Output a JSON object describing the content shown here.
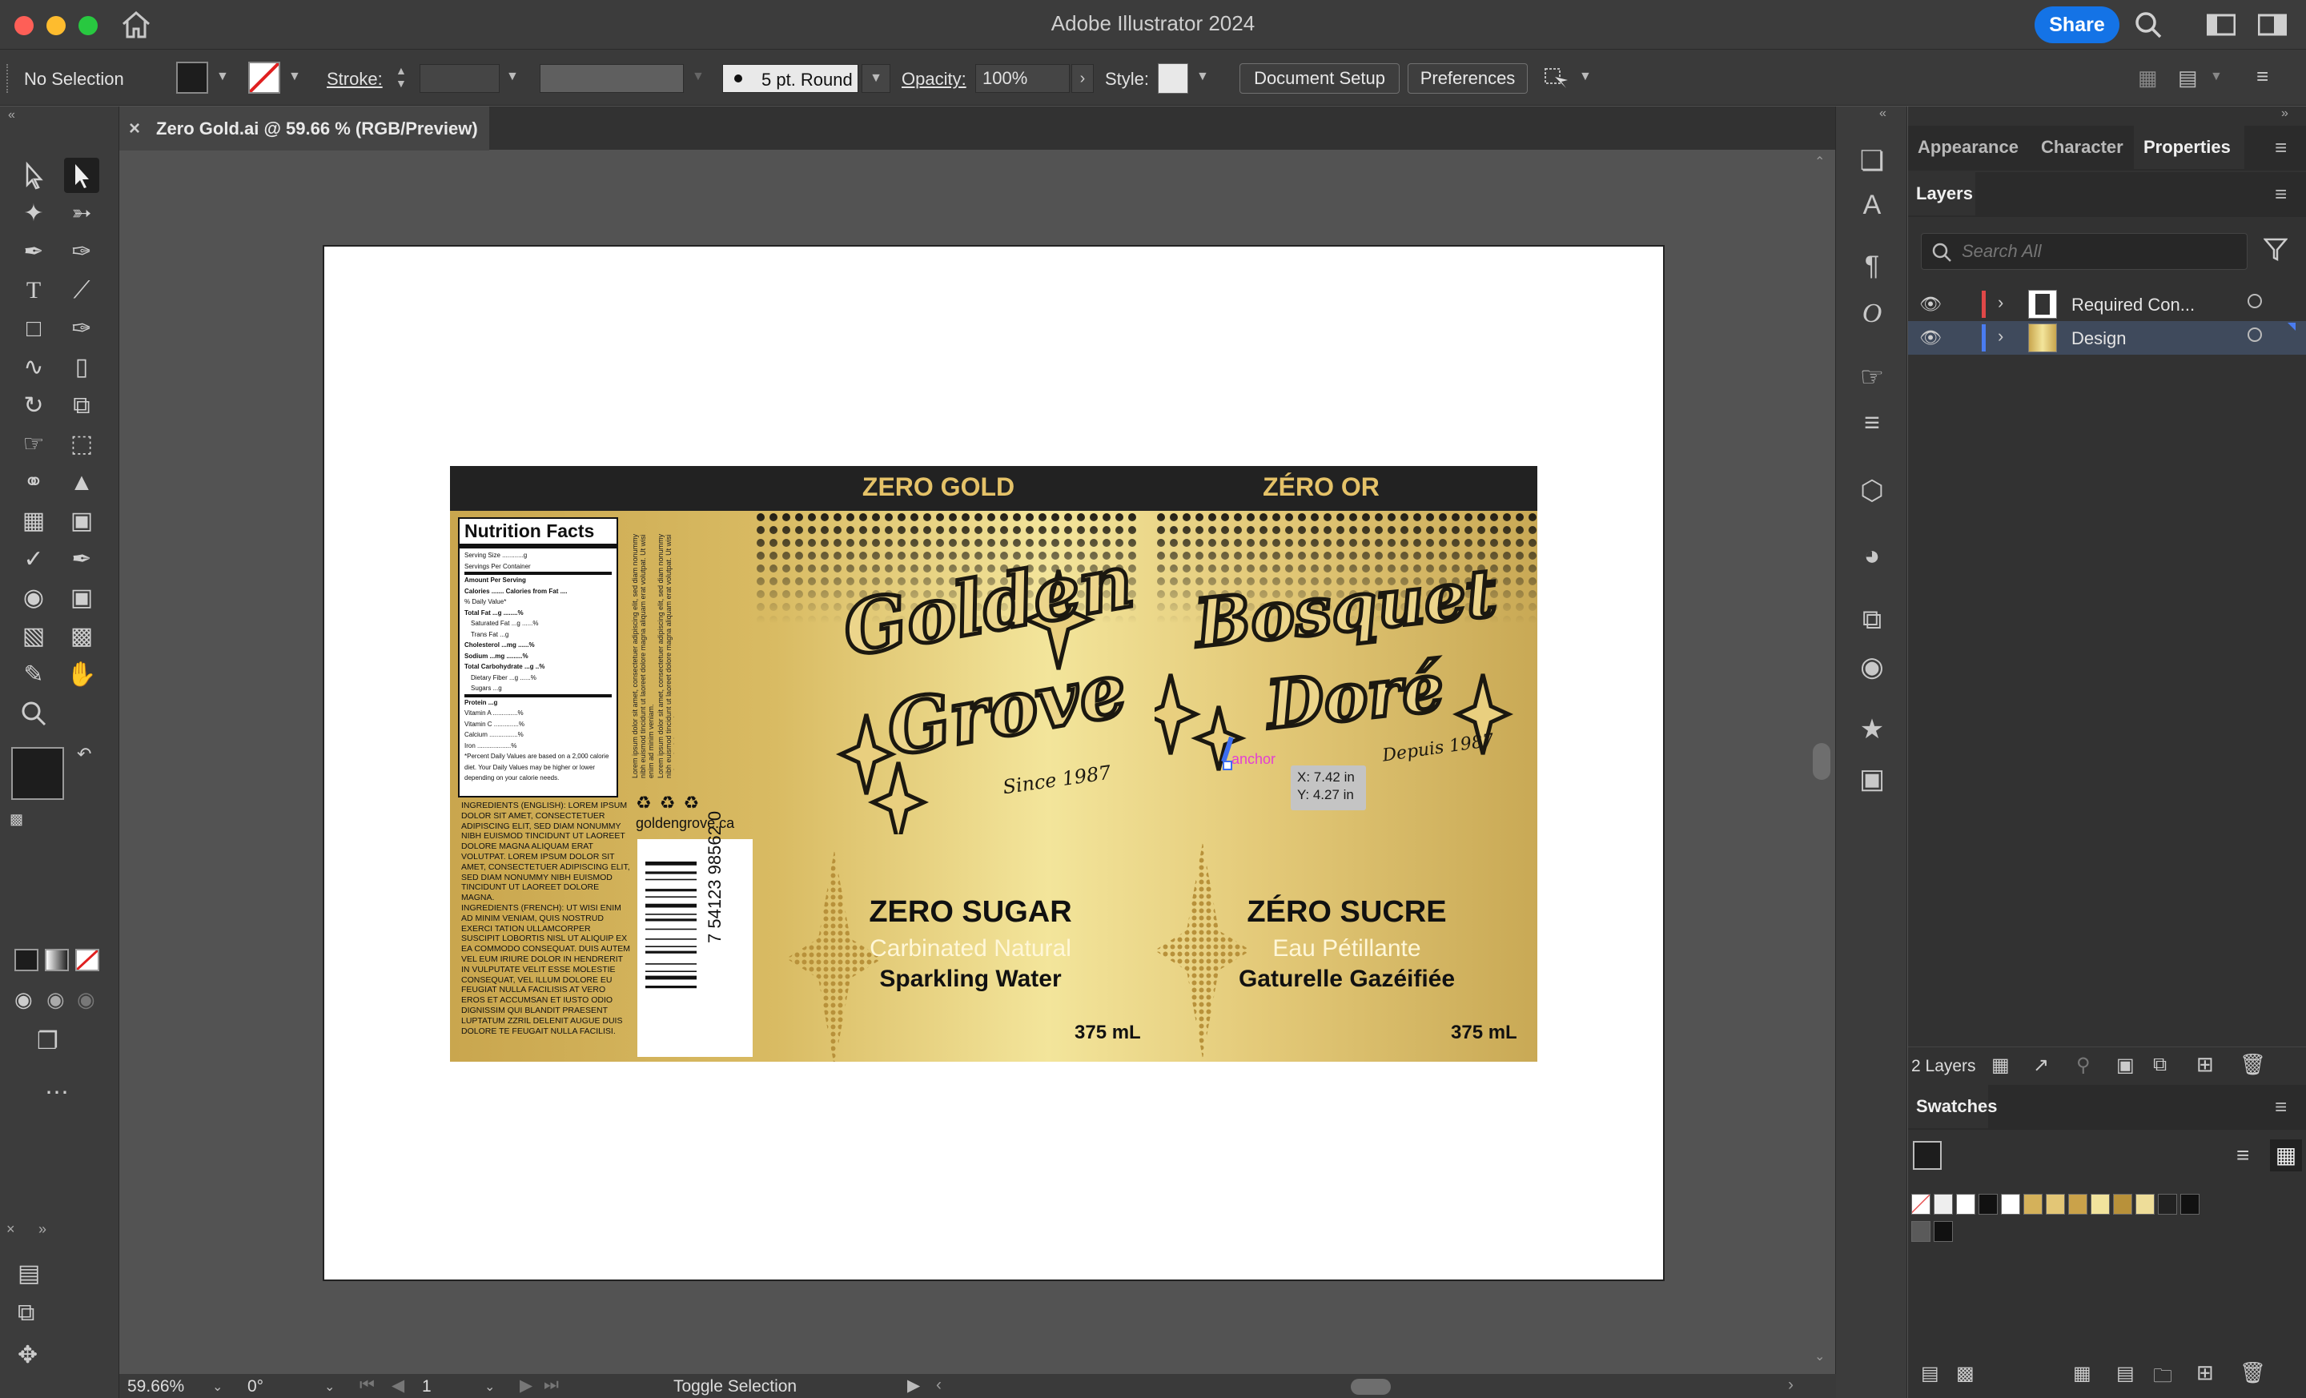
{
  "app": {
    "title": "Adobe Illustrator 2024",
    "share_label": "Share"
  },
  "control_bar": {
    "selection_status": "No Selection",
    "stroke_label": "Stroke:",
    "brush_label": "5 pt. Round",
    "opacity_label": "Opacity:",
    "opacity_value": "100%",
    "style_label": "Style:",
    "document_setup_label": "Document Setup",
    "preferences_label": "Preferences"
  },
  "document_tab": {
    "title": "Zero Gold.ai @ 59.66 % (RGB/Preview)",
    "close_glyph": "×"
  },
  "artwork": {
    "band_left": "ZERO GOLD",
    "band_right": "ZÉRO OR",
    "logo_left_line1": "Golden",
    "logo_left_line2": "Grove",
    "logo_left_since": "Since 1987",
    "logo_right_line1": "Bosquet",
    "logo_right_line2": "Doré",
    "logo_right_since": "Depuis 1987",
    "left_headline": "ZERO SUGAR",
    "left_sub1": "Carbinated Natural",
    "left_sub2": "Sparkling Water",
    "right_headline": "ZÉRO SUCRE",
    "right_sub1": "Eau Pétillante",
    "right_sub2": "Gaturelle Gazéifiée",
    "volume_left": "375 mL",
    "volume_right": "375 mL",
    "website": "goldengrove.ca",
    "barcode_number": "7 54123 98562 0",
    "nutrition_title": "Nutrition Facts",
    "nutrition_rows": [
      "Serving Size ............g",
      "Servings Per Container",
      "Amount Per Serving",
      "Calories .......   Calories from Fat ....",
      "% Daily Value*",
      "Total Fat ...g ........%",
      "Saturated Fat ...g ......%",
      "Trans Fat ...g",
      "Cholesterol ...mg ......%",
      "Sodium ...mg .........%",
      "Total Carbohydrate ...g ..%",
      "Dietary Fiber ...g ......%",
      "Sugars ...g",
      "Protein ...g",
      "Vitamin A ..............%",
      "Vitamin C ..............%",
      "Calcium ................%",
      "Iron ...................%",
      "*Percent Daily Values are based on a 2,000 calorie diet. Your Daily Values may be higher or lower depending on your calorie needs."
    ],
    "ingredients_en": "INGREDIENTS (ENGLISH): LOREM IPSUM DOLOR SIT AMET, CONSECTETUER ADIPISCING ELIT, SED DIAM NONUMMY NIBH EUISMOD TINCIDUNT UT LAOREET DOLORE MAGNA ALIQUAM ERAT VOLUTPAT. LOREM IPSUM DOLOR SIT AMET, CONSECTETUER ADIPISCING ELIT, SED DIAM NONUMMY NIBH EUISMOD TINCIDUNT UT LAOREET DOLORE MAGNA.",
    "ingredients_fr": "INGREDIENTS (FRENCH): UT WISI ENIM AD MINIM VENIAM, QUIS NOSTRUD EXERCI TATION ULLAMCORPER SUSCIPIT LOBORTIS NISL UT ALIQUIP EX EA COMMODO CONSEQUAT. DUIS AUTEM VEL EUM IRIURE DOLOR IN HENDRERIT IN VULPUTATE VELIT ESSE MOLESTIE CONSEQUAT, VEL ILLUM DOLORE EU FEUGIAT NULLA FACILISIS AT VERO EROS ET ACCUMSAN ET IUSTO ODIO DIGNISSIM QUI BLANDIT PRAESENT LUPTATUM ZZRIL DELENIT AUGUE DUIS DOLORE TE FEUGAIT NULLA FACILISI.",
    "vertical_text": "Lorem ipsum dolor sit amet, consectetuer adipiscing elit, sed diam nonummy nibh euismod tincidunt ut laoreet dolore magna aliquam erat volutpat. Ut wisi enim ad minim veniam."
  },
  "smart_guide": {
    "anchor_label": "anchor",
    "x_readout": "X: 7.42 in",
    "y_readout": "Y: 4.27 in"
  },
  "right_panel": {
    "tabs": [
      "Appearance",
      "Character",
      "Properties"
    ],
    "layers_tab": "Layers",
    "search_placeholder": "Search All",
    "layers": [
      {
        "name": "Required Con...",
        "color": "#e04848"
      },
      {
        "name": "Design",
        "color": "#4a7cf0"
      }
    ],
    "layer_count": "2 Layers",
    "swatches_tab": "Swatches"
  },
  "status_bar": {
    "zoom": "59.66%",
    "rotation": "0°",
    "artboard_num": "1",
    "mode": "Toggle Selection"
  },
  "colors": {
    "accent_blue": "#1473e6",
    "label_dark": "#222222",
    "gold_light": "#f3e59b",
    "gold_dark": "#c9a64e"
  }
}
